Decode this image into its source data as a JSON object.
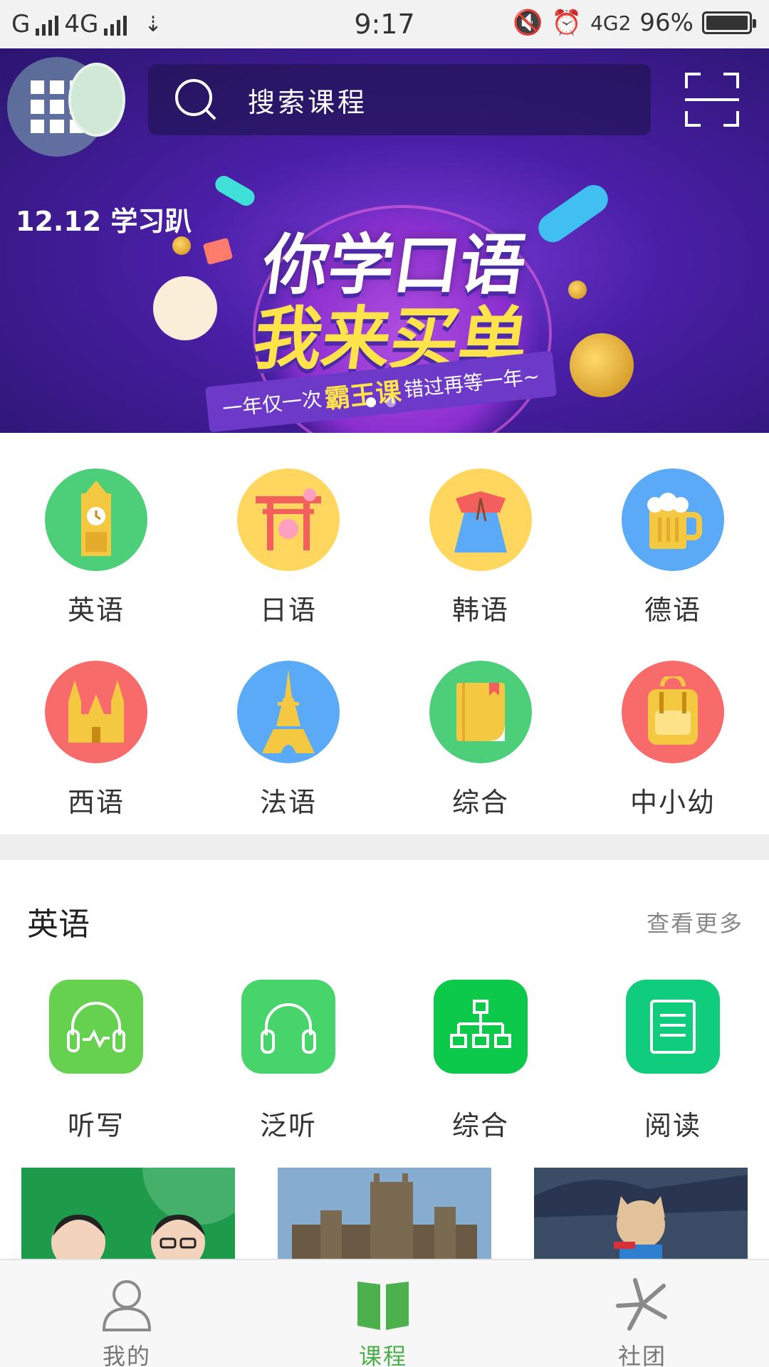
{
  "status_bar": {
    "carrier1": "G",
    "carrier2": "4G",
    "time": "9:17",
    "network": "4G2",
    "battery": "96%"
  },
  "header": {
    "search_placeholder": "搜索课程"
  },
  "banner": {
    "tag": "12.12 学习趴",
    "headline_line1": "你学口语",
    "headline_line2": "我来买单",
    "ribbon_prefix": "一年仅一次",
    "ribbon_highlight": "霸王课",
    "ribbon_suffix": "错过再等一年~",
    "slide_count": 2,
    "active_slide": 1
  },
  "categories": [
    {
      "label": "英语",
      "color": "#4ccf78",
      "icon": "clock-tower-icon"
    },
    {
      "label": "日语",
      "color": "#ffd75e",
      "icon": "torii-gate-icon"
    },
    {
      "label": "韩语",
      "color": "#ffd75e",
      "icon": "hanbok-icon"
    },
    {
      "label": "德语",
      "color": "#5aaaf7",
      "icon": "beer-mug-icon"
    },
    {
      "label": "西语",
      "color": "#f76b6b",
      "icon": "cathedral-icon"
    },
    {
      "label": "法语",
      "color": "#5aaaf7",
      "icon": "eiffel-tower-icon"
    },
    {
      "label": "综合",
      "color": "#4ccf78",
      "icon": "book-icon"
    },
    {
      "label": "中小幼",
      "color": "#f76b6b",
      "icon": "backpack-icon"
    }
  ],
  "english_section": {
    "title": "英语",
    "more": "查看更多",
    "items": [
      {
        "label": "听写",
        "color": "#66d04f",
        "icon": "headphones-wave-icon"
      },
      {
        "label": "泛听",
        "color": "#47d46a",
        "icon": "headphones-icon"
      },
      {
        "label": "综合",
        "color": "#0cc94a",
        "icon": "hierarchy-icon"
      },
      {
        "label": "阅读",
        "color": "#0fcd7c",
        "icon": "document-icon"
      }
    ]
  },
  "tabbar": {
    "tabs": [
      {
        "label": "我的",
        "icon": "person-icon"
      },
      {
        "label": "课程",
        "icon": "open-book-icon"
      },
      {
        "label": "社团",
        "icon": "community-icon"
      }
    ],
    "active_tab": "课程",
    "active_color": "#4cb04c"
  }
}
